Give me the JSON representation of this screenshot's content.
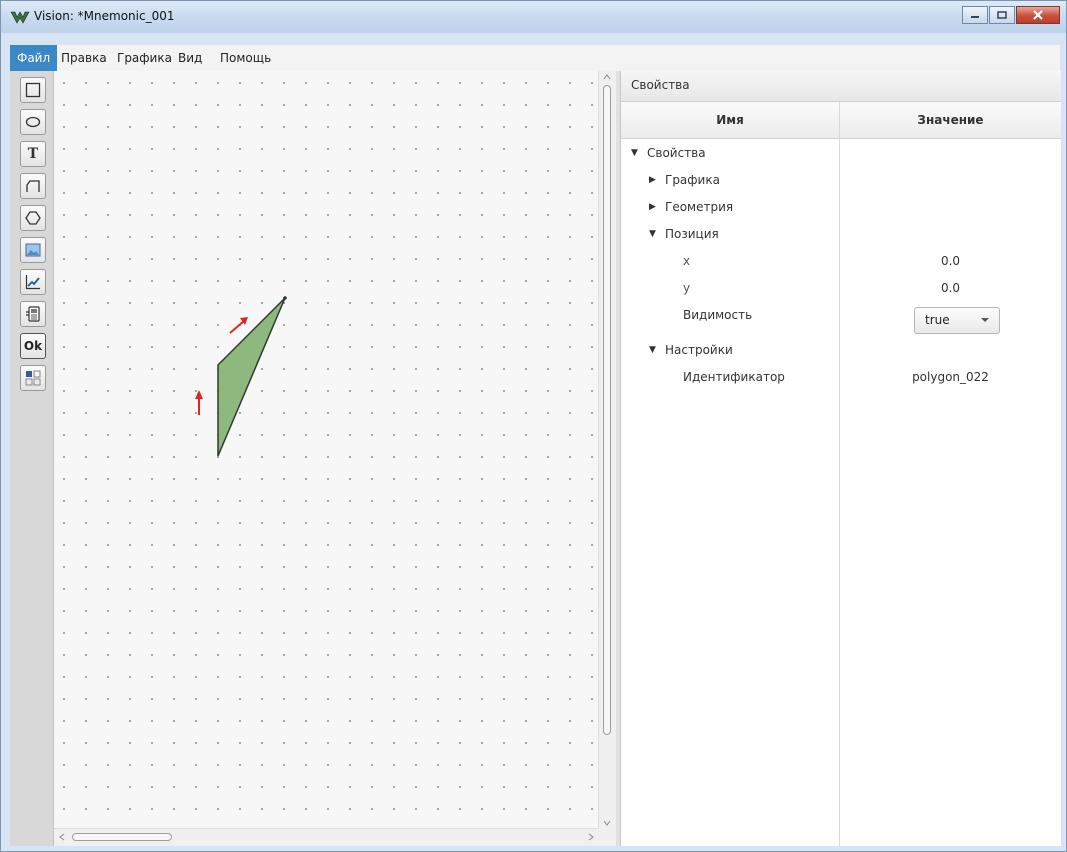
{
  "window": {
    "title": "Vision: *Mnemonic_001"
  },
  "menu": {
    "items": [
      "Файл",
      "Правка",
      "Графика",
      "Вид",
      "Помощь"
    ]
  },
  "toolbar": {
    "tools": [
      "rectangle-icon",
      "ellipse-icon",
      "text-icon",
      "polyline-icon",
      "polygon-icon",
      "image-icon",
      "trend-chart-icon",
      "device-icon",
      "ok-button-icon",
      "grid-icon"
    ],
    "text_tool_label": "T",
    "ok_tool_label": "Ok"
  },
  "canvas": {
    "shape": "polygon",
    "fill_color": "#8db97f",
    "stroke_color": "#2f3a2f",
    "arrow_color": "#e0261c"
  },
  "properties": {
    "panel_title": "Свойства",
    "col_name": "Имя",
    "col_value": "Значение",
    "tree": {
      "root": "Свойства",
      "graphics": "Графика",
      "geometry": "Геометрия",
      "position": "Позиция",
      "x_label": "x",
      "x_value": "0.0",
      "y_label": "y",
      "y_value": "0.0",
      "visibility_label": "Видимость",
      "visibility_value": "true",
      "settings": "Настройки",
      "id_label": "Идентификатор",
      "id_value": "polygon_022"
    }
  }
}
